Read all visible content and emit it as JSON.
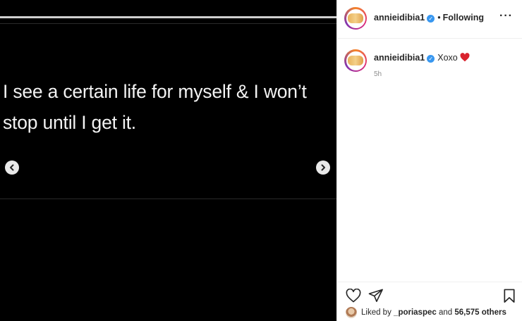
{
  "media": {
    "caption": "I see a certain life for myself & I won’t\nstop until I get it.",
    "prev_icon": "chevron-left-icon",
    "next_icon": "chevron-right-icon"
  },
  "header": {
    "username": "annieidibia1",
    "separator": "•",
    "follow_status": "Following",
    "more_icon": "more-horizontal-icon",
    "more_glyph": "···"
  },
  "comment": {
    "username": "annieidibia1",
    "message": "Xoxo",
    "emoji": "heart-icon",
    "time": "5h"
  },
  "actions": {
    "like_icon": "heart-outline-icon",
    "share_icon": "paper-plane-icon",
    "save_icon": "bookmark-icon"
  },
  "likes": {
    "prefix": "Liked by",
    "user": "_poriaspec",
    "connector": "and",
    "count_text": "56,575 others"
  },
  "colors": {
    "media_bg": "#000000",
    "verified_blue": "#3897f0",
    "heart_red": "#d9232e",
    "text_primary": "#262626",
    "text_secondary": "#8e8e8e"
  }
}
